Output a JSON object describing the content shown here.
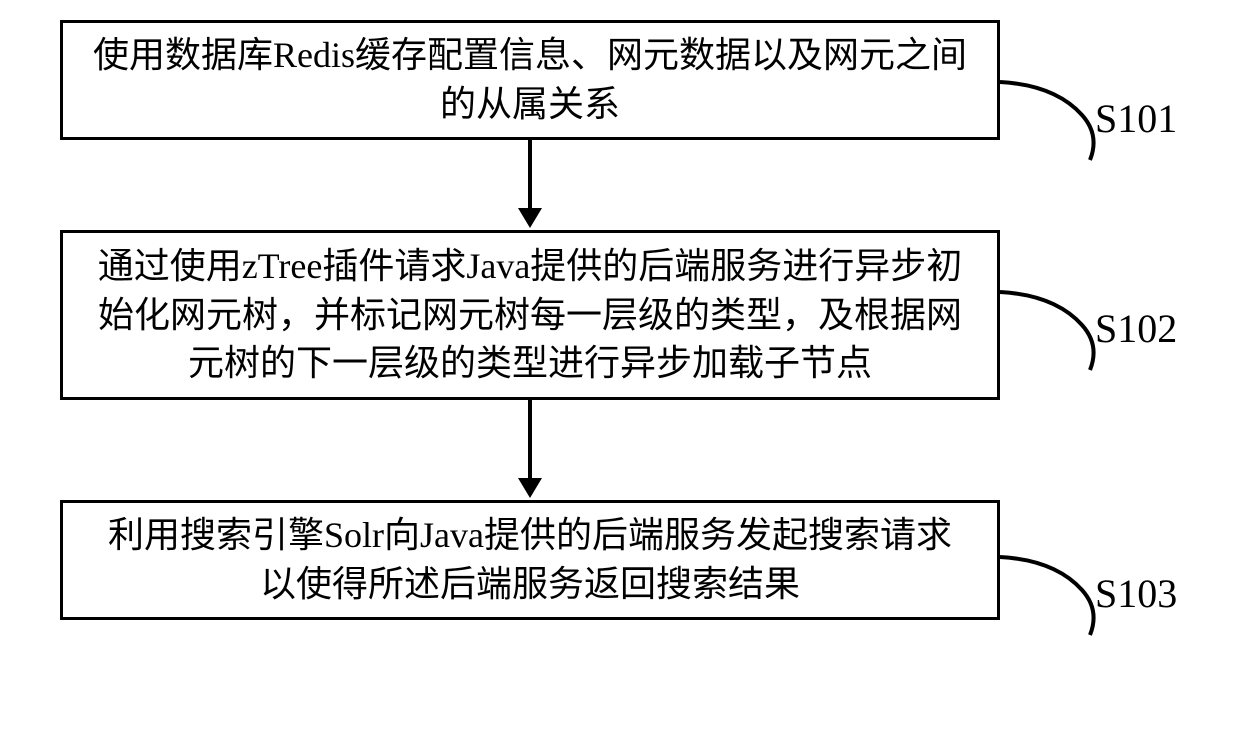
{
  "steps": {
    "s1": {
      "label": "S101",
      "text": "使用数据库Redis缓存配置信息、网元数据以及网元之间的从属关系"
    },
    "s2": {
      "label": "S102",
      "text": "通过使用zTree插件请求Java提供的后端服务进行异步初始化网元树，并标记网元树每一层级的类型，及根据网元树的下一层级的类型进行异步加载子节点"
    },
    "s3": {
      "label": "S103",
      "text": "利用搜索引擎Solr向Java提供的后端服务发起搜索请求以使得所述后端服务返回搜索结果"
    }
  }
}
